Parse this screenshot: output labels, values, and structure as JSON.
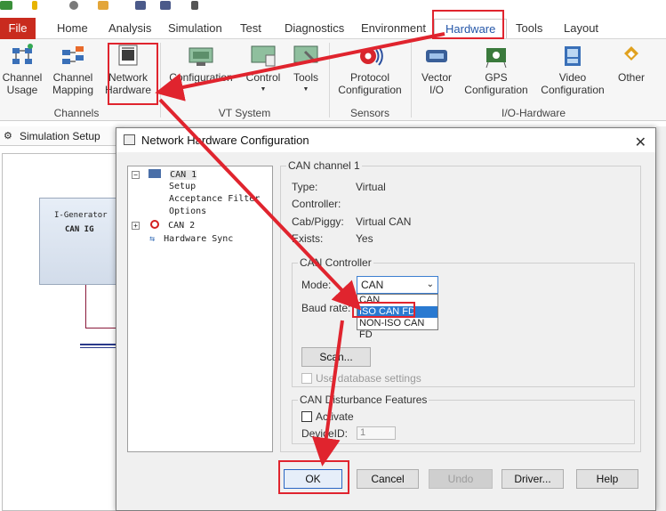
{
  "ribbon_tabs": [
    "File",
    "Home",
    "Analysis",
    "Simulation",
    "Test",
    "Diagnostics",
    "Environment",
    "Hardware",
    "Tools",
    "Layout"
  ],
  "ribbon": {
    "channel_usage": "Channel\nUsage",
    "channel_mapping": "Channel\nMapping",
    "network_hardware": "Network\nHardware",
    "configuration": "Configuration",
    "control": "Control",
    "tools": "Tools",
    "protocol_configuration": "Protocol\nConfiguration",
    "vector_io": "Vector\nI/O",
    "gps_configuration": "GPS\nConfiguration",
    "video_configuration": "Video\nConfiguration",
    "other": "Other",
    "groups": {
      "channels": "Channels",
      "vt_system": "VT System",
      "sensors": "Sensors",
      "io_hardware": "I/O-Hardware"
    }
  },
  "simulation_setup": {
    "title": "Simulation Setup",
    "node_title": "I-Generator",
    "node_sub": "CAN IG"
  },
  "dialog": {
    "title": "Network Hardware Configuration",
    "tree": {
      "can1": "CAN 1",
      "setup": "Setup",
      "acceptance_filter": "Acceptance Filter",
      "options": "Options",
      "can2": "CAN 2",
      "hardware_sync": "Hardware Sync"
    },
    "channel_title": "CAN channel 1",
    "props": {
      "type_label": "Type:",
      "type_value": "Virtual",
      "controller_label": "Controller:",
      "controller_value": "",
      "cab_label": "Cab/Piggy:",
      "cab_value": "Virtual CAN",
      "exists_label": "Exists:",
      "exists_value": "Yes"
    },
    "can_controller": {
      "title": "CAN Controller",
      "mode_label": "Mode:",
      "mode_value": "CAN",
      "baud_label": "Baud rate:",
      "options": [
        "CAN",
        "ISO CAN FD",
        "NON-ISO CAN FD"
      ],
      "selected_option": "ISO CAN FD",
      "scan_button": "Scan...",
      "use_db": "Use database settings"
    },
    "disturbance": {
      "title": "CAN Disturbance Features",
      "activate": "Activate",
      "device_id_label": "DeviceID:",
      "device_id_value": "1"
    },
    "buttons": {
      "ok": "OK",
      "cancel": "Cancel",
      "undo": "Undo",
      "driver": "Driver...",
      "help": "Help"
    }
  },
  "colors": {
    "file_tab": "#c92b1e",
    "highlight": "#e0242e",
    "selection": "#2a7ad1",
    "hardware_tab_text": "#2456a8"
  }
}
